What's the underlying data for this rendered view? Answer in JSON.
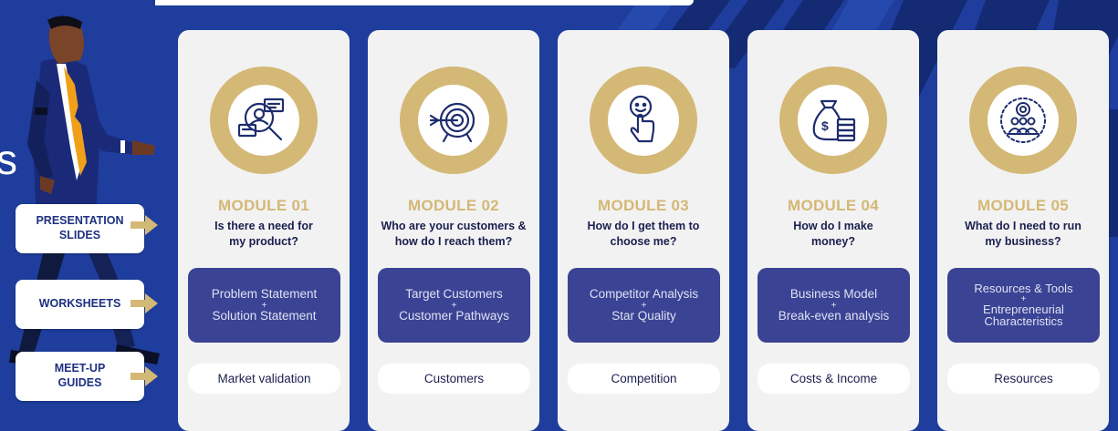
{
  "colors": {
    "background": "#1e3d9c",
    "gold": "#d4b876",
    "navy_box": "#3a4394",
    "card": "#f2f2f2",
    "dark_text": "#1a1f4f"
  },
  "side_letter": "s",
  "side_buttons": [
    {
      "label": "PRESENTATION SLIDES"
    },
    {
      "label": "WORKSHEETS"
    },
    {
      "label": "MEET-UP GUIDES"
    }
  ],
  "modules": [
    {
      "icon": "market-research-icon",
      "title": "MODULE 01",
      "question": "Is there a need for my product?",
      "box_line1": "Problem Statement",
      "box_plus": "+",
      "box_line2": "Solution Statement",
      "pill": "Market validation"
    },
    {
      "icon": "target-icon",
      "title": "MODULE 02",
      "question": "Who are your customers & how do I reach them?",
      "box_line1": "Target Customers",
      "box_plus": "+",
      "box_line2": "Customer Pathways",
      "pill": "Customers"
    },
    {
      "icon": "finger-choice-icon",
      "title": "MODULE 03",
      "question": "How do I get them to choose me?",
      "box_line1": "Competitor Analysis",
      "box_plus": "+",
      "box_line2": "Star Quality",
      "pill": "Competition"
    },
    {
      "icon": "money-bag-icon",
      "title": "MODULE 04",
      "question": "How do I make money?",
      "box_line1": "Business Model",
      "box_plus": "+",
      "box_line2": "Break-even analysis",
      "pill": "Costs & Income"
    },
    {
      "icon": "team-gear-icon",
      "title": "MODULE 05",
      "question": "What do I need to run my business?",
      "box_line1": "Resources & Tools",
      "box_plus": "+",
      "box_line2": "Entrepreneurial Characteristics",
      "pill": "Resources"
    }
  ]
}
